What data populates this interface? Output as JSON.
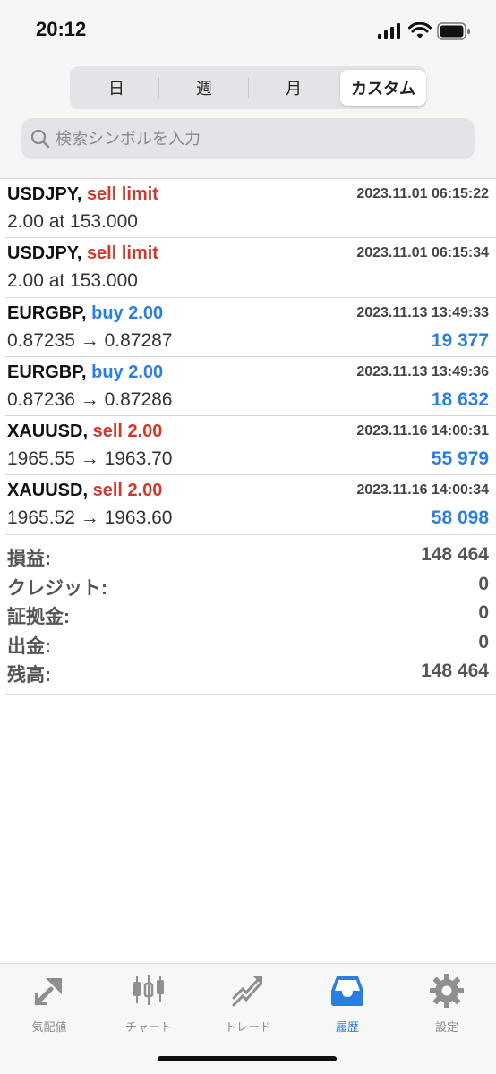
{
  "status_bar": {
    "time": "20:12"
  },
  "period_tabs": [
    {
      "label": "日",
      "active": false
    },
    {
      "label": "週",
      "active": false
    },
    {
      "label": "月",
      "active": false
    },
    {
      "label": "カスタム",
      "active": true
    }
  ],
  "search": {
    "placeholder": "検索シンボルを入力",
    "value": ""
  },
  "orders": [
    {
      "symbol": "USDJPY,",
      "type": "sell limit",
      "direction": "sell",
      "date": "2023.11.01 06:15:22",
      "detail": "2.00 at 153.000",
      "profit": ""
    },
    {
      "symbol": "USDJPY,",
      "type": "sell limit",
      "direction": "sell",
      "date": "2023.11.01 06:15:34",
      "detail": "2.00 at 153.000",
      "profit": ""
    },
    {
      "symbol": "EURGBP,",
      "type": "buy 2.00",
      "direction": "buy",
      "date": "2023.11.13 13:49:33",
      "detail": "0.87235 → 0.87287",
      "profit": "19 377"
    },
    {
      "symbol": "EURGBP,",
      "type": "buy 2.00",
      "direction": "buy",
      "date": "2023.11.13 13:49:36",
      "detail": "0.87236 → 0.87286",
      "profit": "18 632"
    },
    {
      "symbol": "XAUUSD,",
      "type": "sell 2.00",
      "direction": "sell",
      "date": "2023.11.16 14:00:31",
      "detail": "1965.55 → 1963.70",
      "profit": "55 979"
    },
    {
      "symbol": "XAUUSD,",
      "type": "sell 2.00",
      "direction": "sell",
      "date": "2023.11.16 14:00:34",
      "detail": "1965.52 → 1963.60",
      "profit": "58 098"
    }
  ],
  "summary": [
    {
      "label": "損益:",
      "value": "148 464"
    },
    {
      "label": "クレジット:",
      "value": "0"
    },
    {
      "label": "証拠金:",
      "value": "0"
    },
    {
      "label": "出金:",
      "value": "0"
    },
    {
      "label": "残高:",
      "value": "148 464"
    }
  ],
  "tab_bar": [
    {
      "label": "気配値",
      "icon": "quotes-icon",
      "active": false
    },
    {
      "label": "チャート",
      "icon": "chart-icon",
      "active": false
    },
    {
      "label": "トレード",
      "icon": "trade-icon",
      "active": false
    },
    {
      "label": "履歴",
      "icon": "history-icon",
      "active": true
    },
    {
      "label": "設定",
      "icon": "settings-icon",
      "active": false
    }
  ],
  "colors": {
    "sell": "#d0392b",
    "buy": "#2a7de1",
    "accent": "#2a7de1",
    "inactive": "#8e8e93"
  }
}
